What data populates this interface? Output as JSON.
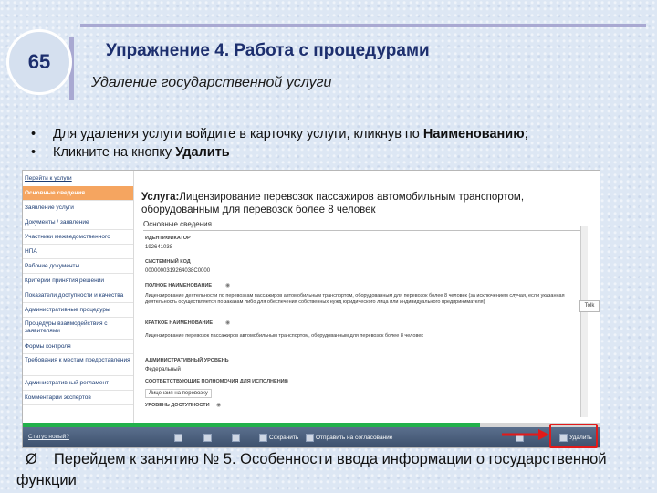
{
  "slide": {
    "number": "65",
    "title": "Упражнение 4. Работа с процедурами",
    "subtitle": "Удаление государственной услуги",
    "bullets": [
      {
        "marker": "•",
        "text": "Для удаления услуги войдите в карточку услуги, кликнув по ",
        "bold": "Наименованию",
        "tail": ";"
      },
      {
        "marker": "•",
        "text": "Кликните на кнопку ",
        "bold": "Удалить",
        "tail": ""
      }
    ],
    "footer": {
      "marker": "Ø",
      "text": "Перейдем к занятию № 5. Особенности ввода информации о государственной функции"
    }
  },
  "app": {
    "back_link": "Перейти к услуги",
    "sidebar_items": [
      {
        "label": "Основные сведения",
        "active": true
      },
      {
        "label": "Заявление услуги",
        "active": false
      },
      {
        "label": "Документы / заявление",
        "active": false
      },
      {
        "label": "Участники межведомственного",
        "active": false
      },
      {
        "label": "НПА",
        "active": false
      },
      {
        "label": "Рабочие документы",
        "active": false
      },
      {
        "label": "Критерии принятия решений",
        "active": false
      },
      {
        "label": "Показатели доступности и качества",
        "active": false
      },
      {
        "label": "Административные процедуры",
        "active": false
      },
      {
        "label": "Процедуры взаимодействия с заявителями",
        "active": false
      },
      {
        "label": "Формы контроля",
        "active": false
      },
      {
        "label": "Требования к местам предоставления",
        "active": false
      },
      {
        "label": "Административный регламент",
        "active": false
      },
      {
        "label": "Комментарии экспертов",
        "active": false
      }
    ],
    "service_prefix": "Услуга:",
    "service_title": "Лицензирование перевозок пассажиров автомобильным транспортом, оборудованным для перевозок более 8 человек",
    "section_tab": "Основные сведения",
    "fields": {
      "id_label": "ИДЕНТИФИКАТОР",
      "id_value": "192641038",
      "system_code_label": "СИСТЕМНЫЙ КОД",
      "system_code_value": "0000000319264038C0000",
      "full_name_label": "ПОЛНОЕ НАИМЕНОВАНИЕ",
      "full_name_value": "Лицензирование деятельности по перевозкам пассажиров автомобильным транспортом, оборудованным для перевозок более 8 человек (за исключением случая, если указанная деятельность осуществляется по заказам либо для обеспечения собственных нужд юридического лица или индивидуального предпринимателя)",
      "short_name_label": "КРАТКОЕ НАИМЕНОВАНИЕ",
      "short_name_value": "Лицензирование перевозок пассажиров автомобильным транспортом, оборудованным для перевозок более 8 человек",
      "admin_level_label": "АДМИНИСТРАТИВНЫЙ УРОВЕНЬ",
      "admin_level_value": "Федеральный",
      "authority_label": "СООТВЕТСТВУЮЩИЕ ПОЛНОМОЧИЯ ДЛЯ ИСПОЛНЕНИЯ",
      "authority_value": "Лицензия на перевозку",
      "access_label": "УРОВЕНЬ ДОСТУПНОСТИ"
    },
    "tooltip": "Tolk",
    "progress_fraction": 0.79,
    "toolbar": {
      "status_link": "Статус новый?",
      "save": "Сохранить",
      "send": "Отправить на согласование",
      "delete": "Удалить"
    }
  },
  "colors": {
    "accent": "#f5a560",
    "progress": "#22b14c",
    "highlight": "#e21a1a",
    "title": "#1d2f6e"
  }
}
